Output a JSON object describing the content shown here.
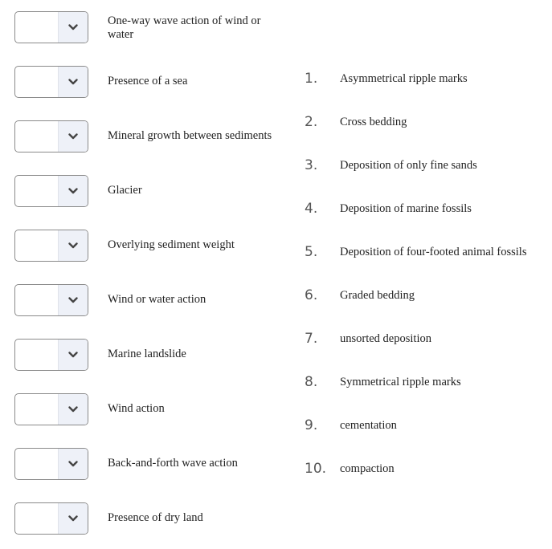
{
  "prompts": [
    {
      "text": "One-way wave action of wind or water",
      "selected": ""
    },
    {
      "text": "Presence of a sea",
      "selected": ""
    },
    {
      "text": "Mineral growth between sediments",
      "selected": ""
    },
    {
      "text": "Glacier",
      "selected": ""
    },
    {
      "text": "Overlying sediment weight",
      "selected": ""
    },
    {
      "text": "Wind or water action",
      "selected": ""
    },
    {
      "text": "Marine landslide",
      "selected": ""
    },
    {
      "text": "Wind action",
      "selected": ""
    },
    {
      "text": "Back-and-forth wave action",
      "selected": ""
    },
    {
      "text": "Presence of dry land",
      "selected": ""
    }
  ],
  "options": [
    {
      "num": "1.",
      "text": "Asymmetrical ripple marks"
    },
    {
      "num": "2.",
      "text": "Cross bedding"
    },
    {
      "num": "3.",
      "text": "Deposition of only fine sands"
    },
    {
      "num": "4.",
      "text": "Deposition of marine fossils"
    },
    {
      "num": "5.",
      "text": "Deposition of four-footed animal fossils"
    },
    {
      "num": "6.",
      "text": "Graded bedding"
    },
    {
      "num": "7.",
      "text": "unsorted deposition"
    },
    {
      "num": "8.",
      "text": "Symmetrical ripple marks"
    },
    {
      "num": "9.",
      "text": "cementation"
    },
    {
      "num": "10.",
      "text": "compaction"
    }
  ],
  "icons": {
    "dropdown": "chevron-down-icon"
  },
  "colors": {
    "dropdown_button_bg": "#eef1f8",
    "dropdown_border": "#8a8a8a",
    "chevron": "#444444",
    "number": "#555555"
  }
}
